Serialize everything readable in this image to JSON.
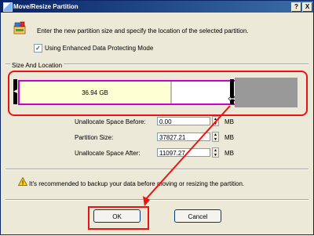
{
  "window": {
    "title": "Move/Resize Partition",
    "help_label": "?",
    "close_label": "X"
  },
  "instruction": "Enter the new partition size and specify the location of the selected partition.",
  "options": {
    "enhanced_mode_label": "Using Enhanced Data Protecting Mode",
    "enhanced_mode_checked": true,
    "check_glyph": "✓"
  },
  "group_title": "Size And Location",
  "partition_map": {
    "used_label": "36.94 GB",
    "used_fraction": 0.77
  },
  "fields": {
    "before_label": "Unallocate Space Before:",
    "before_value": "0.00",
    "before_unit": "MB",
    "size_label": "Partition Size:",
    "size_value": "37827.21",
    "size_unit": "MB",
    "after_label": "Unallocate Space After:",
    "after_value": "11097.27",
    "after_unit": "MB"
  },
  "warning": "It's recommended to backup your data before moving or resizing the partition.",
  "buttons": {
    "ok": "OK",
    "cancel": "Cancel"
  },
  "colors": {
    "title_bar": "#0a246a",
    "partition_border": "#cc00cc",
    "used_fill": "#ffffd4",
    "unallocated": "#999999",
    "annotation": "#ee1111"
  },
  "icons": {
    "title": "app-icon",
    "instruction": "partition-tool-icon",
    "warning": "warning-icon"
  }
}
